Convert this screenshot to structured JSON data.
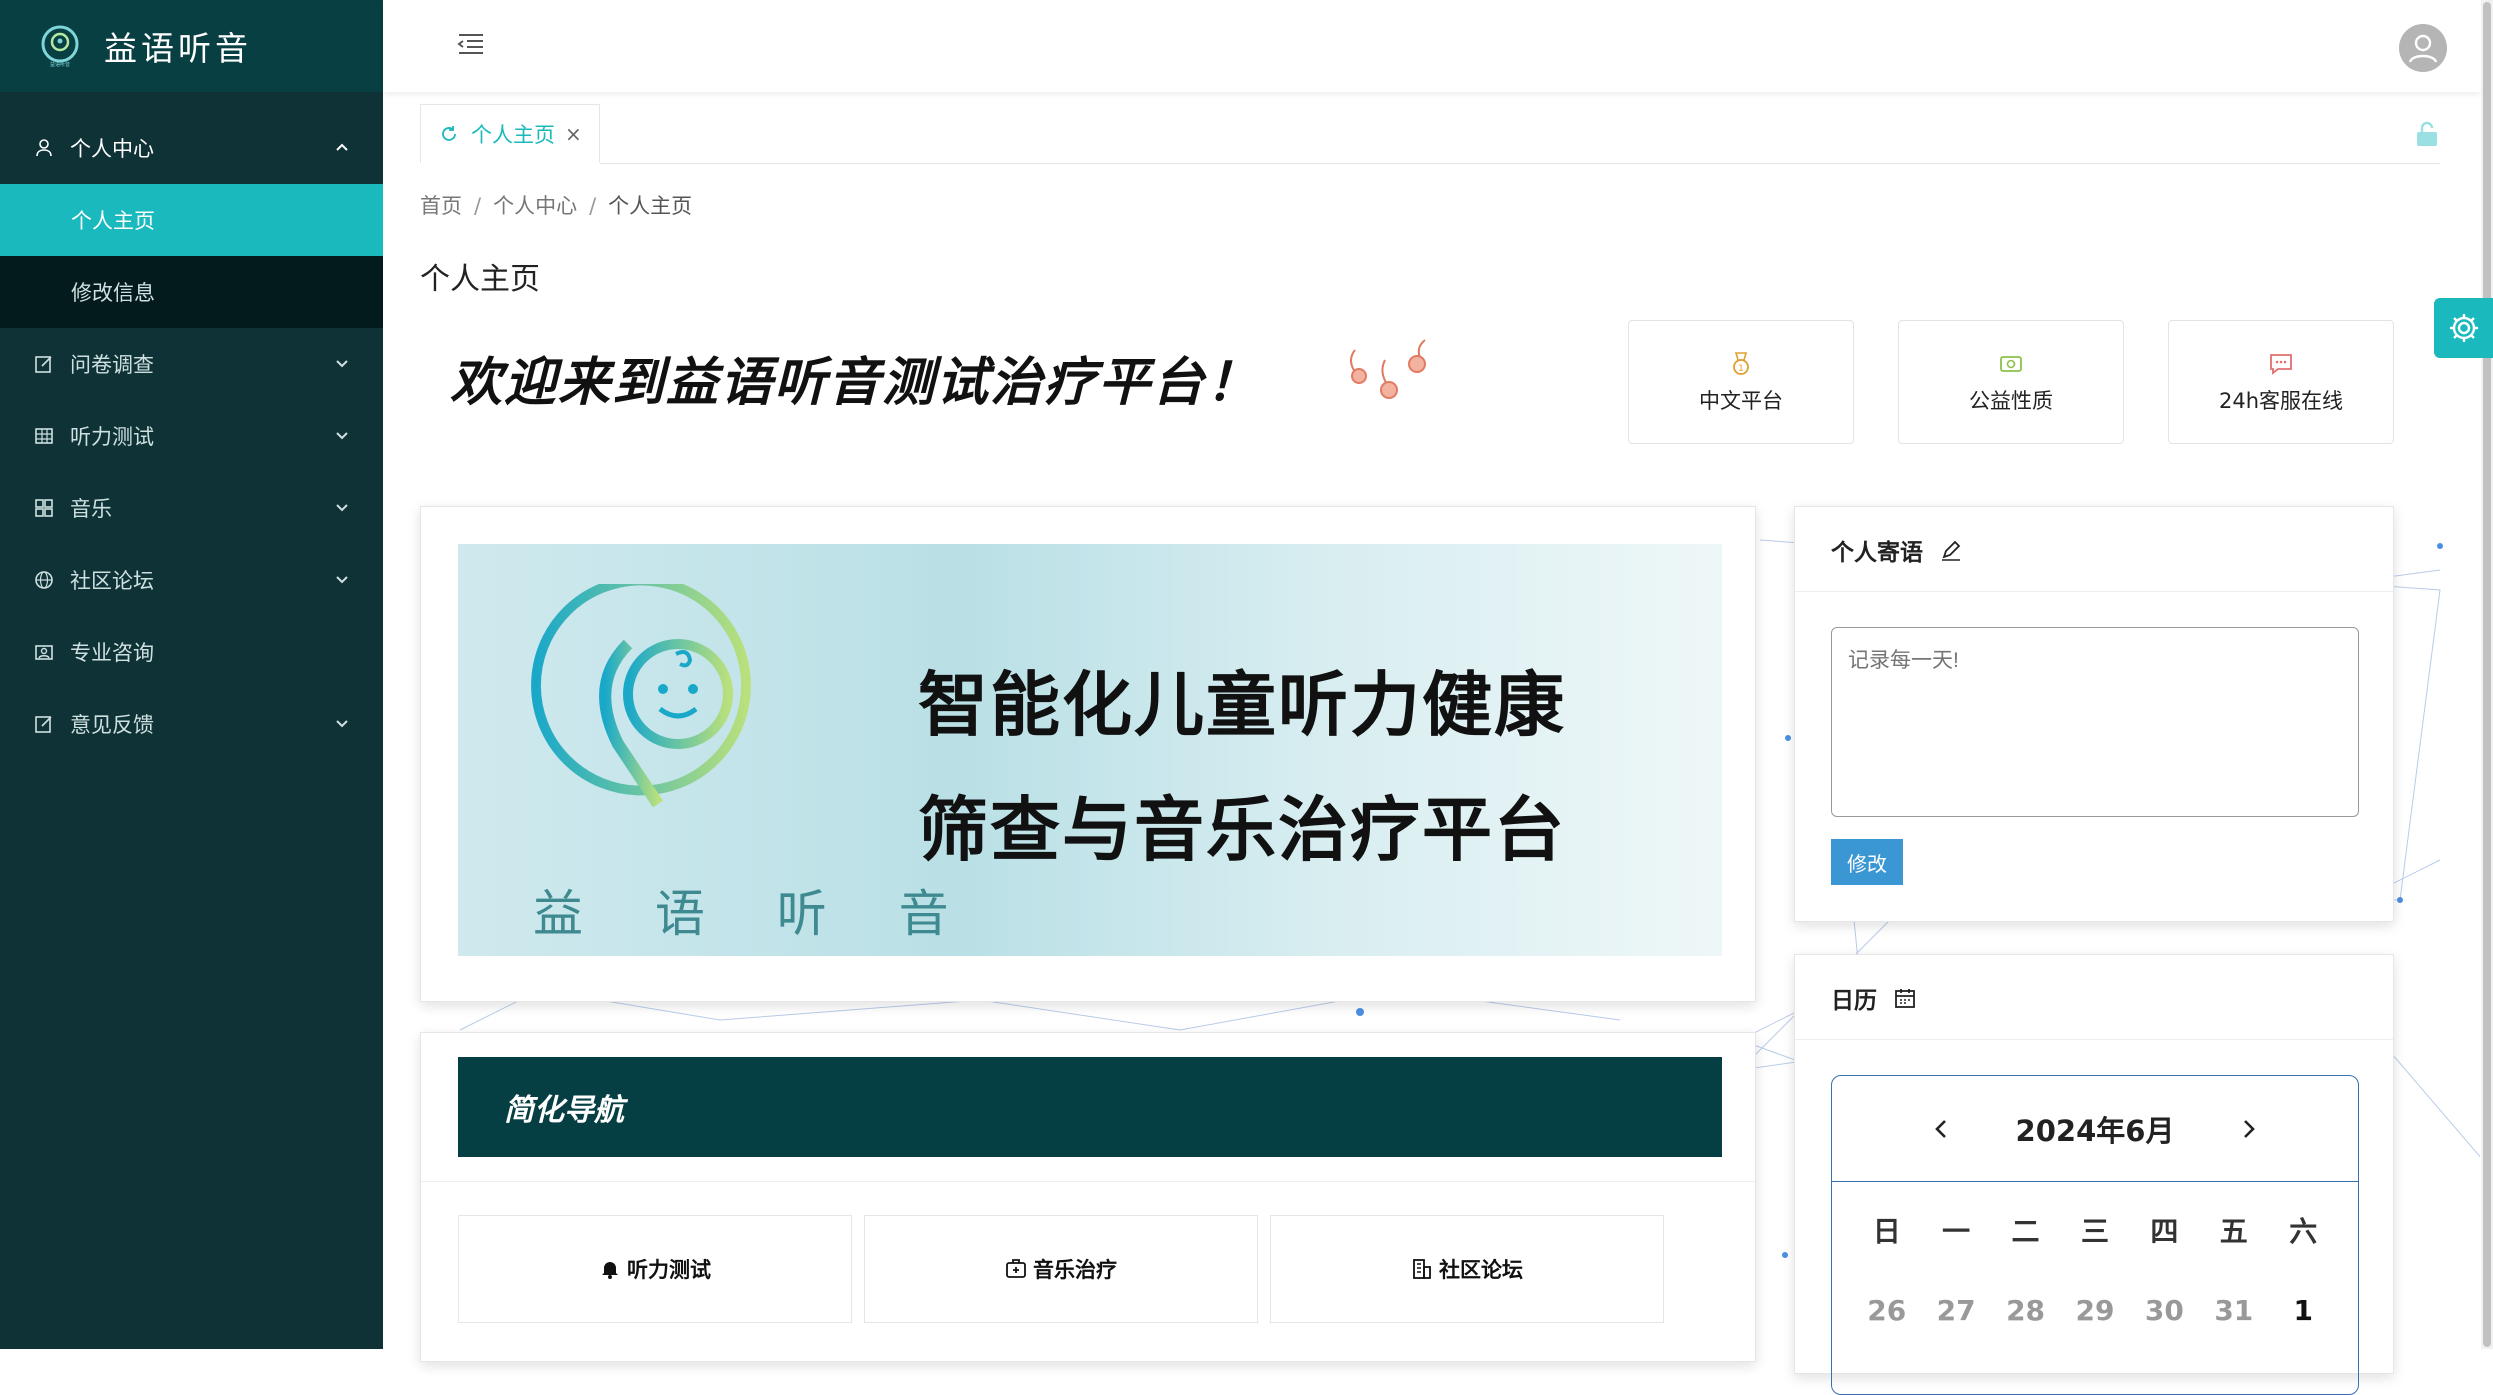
{
  "brand": {
    "name": "益语听音"
  },
  "sidebar": {
    "items": [
      {
        "label": "个人中心",
        "icon": "user-icon",
        "expanded": true,
        "children": [
          {
            "label": "个人主页",
            "active": true
          },
          {
            "label": "修改信息"
          }
        ]
      },
      {
        "label": "问卷调查",
        "icon": "edit-icon"
      },
      {
        "label": "听力测试",
        "icon": "table-icon"
      },
      {
        "label": "音乐",
        "icon": "grid-icon"
      },
      {
        "label": "社区论坛",
        "icon": "globe-icon"
      },
      {
        "label": "专业咨询",
        "icon": "consult-icon"
      },
      {
        "label": "意见反馈",
        "icon": "edit-icon"
      }
    ]
  },
  "tabs": [
    {
      "label": "个人主页",
      "active": true
    }
  ],
  "breadcrumb": {
    "items": [
      "首页",
      "个人中心",
      "个人主页"
    ]
  },
  "page": {
    "title": "个人主页",
    "welcome": "欢迎来到益语听音测试治疗平台！"
  },
  "features": [
    {
      "label": "中文平台",
      "icon": "medal-icon",
      "color": "#e0a030"
    },
    {
      "label": "公益性质",
      "icon": "money-icon",
      "color": "#8bc34a"
    },
    {
      "label": "24h客服在线",
      "icon": "chat-icon",
      "color": "#e07070"
    }
  ],
  "banner": {
    "brand_text": "益 语 听 音",
    "line1": "智能化儿童听力健康",
    "line2": "筛查与音乐治疗平台"
  },
  "nav": {
    "title": "简化导航",
    "buttons": [
      {
        "label": "听力测试",
        "icon": "bell-icon"
      },
      {
        "label": "音乐治疗",
        "icon": "medkit-icon"
      },
      {
        "label": "社区论坛",
        "icon": "building-icon"
      }
    ]
  },
  "message": {
    "title": "个人寄语",
    "placeholder": "记录每一天!",
    "button": "修改"
  },
  "calendar": {
    "title": "日历",
    "month_label": "2024年6月",
    "weekdays": [
      "日",
      "一",
      "二",
      "三",
      "四",
      "五",
      "六"
    ],
    "first_row": [
      "26",
      "27",
      "28",
      "29",
      "30",
      "31",
      "1"
    ]
  },
  "colors": {
    "accent": "#1ab9bd",
    "sidebar_bg": "#0e3236",
    "nav_head_bg": "#053f43",
    "button_blue": "#3a97d4"
  }
}
